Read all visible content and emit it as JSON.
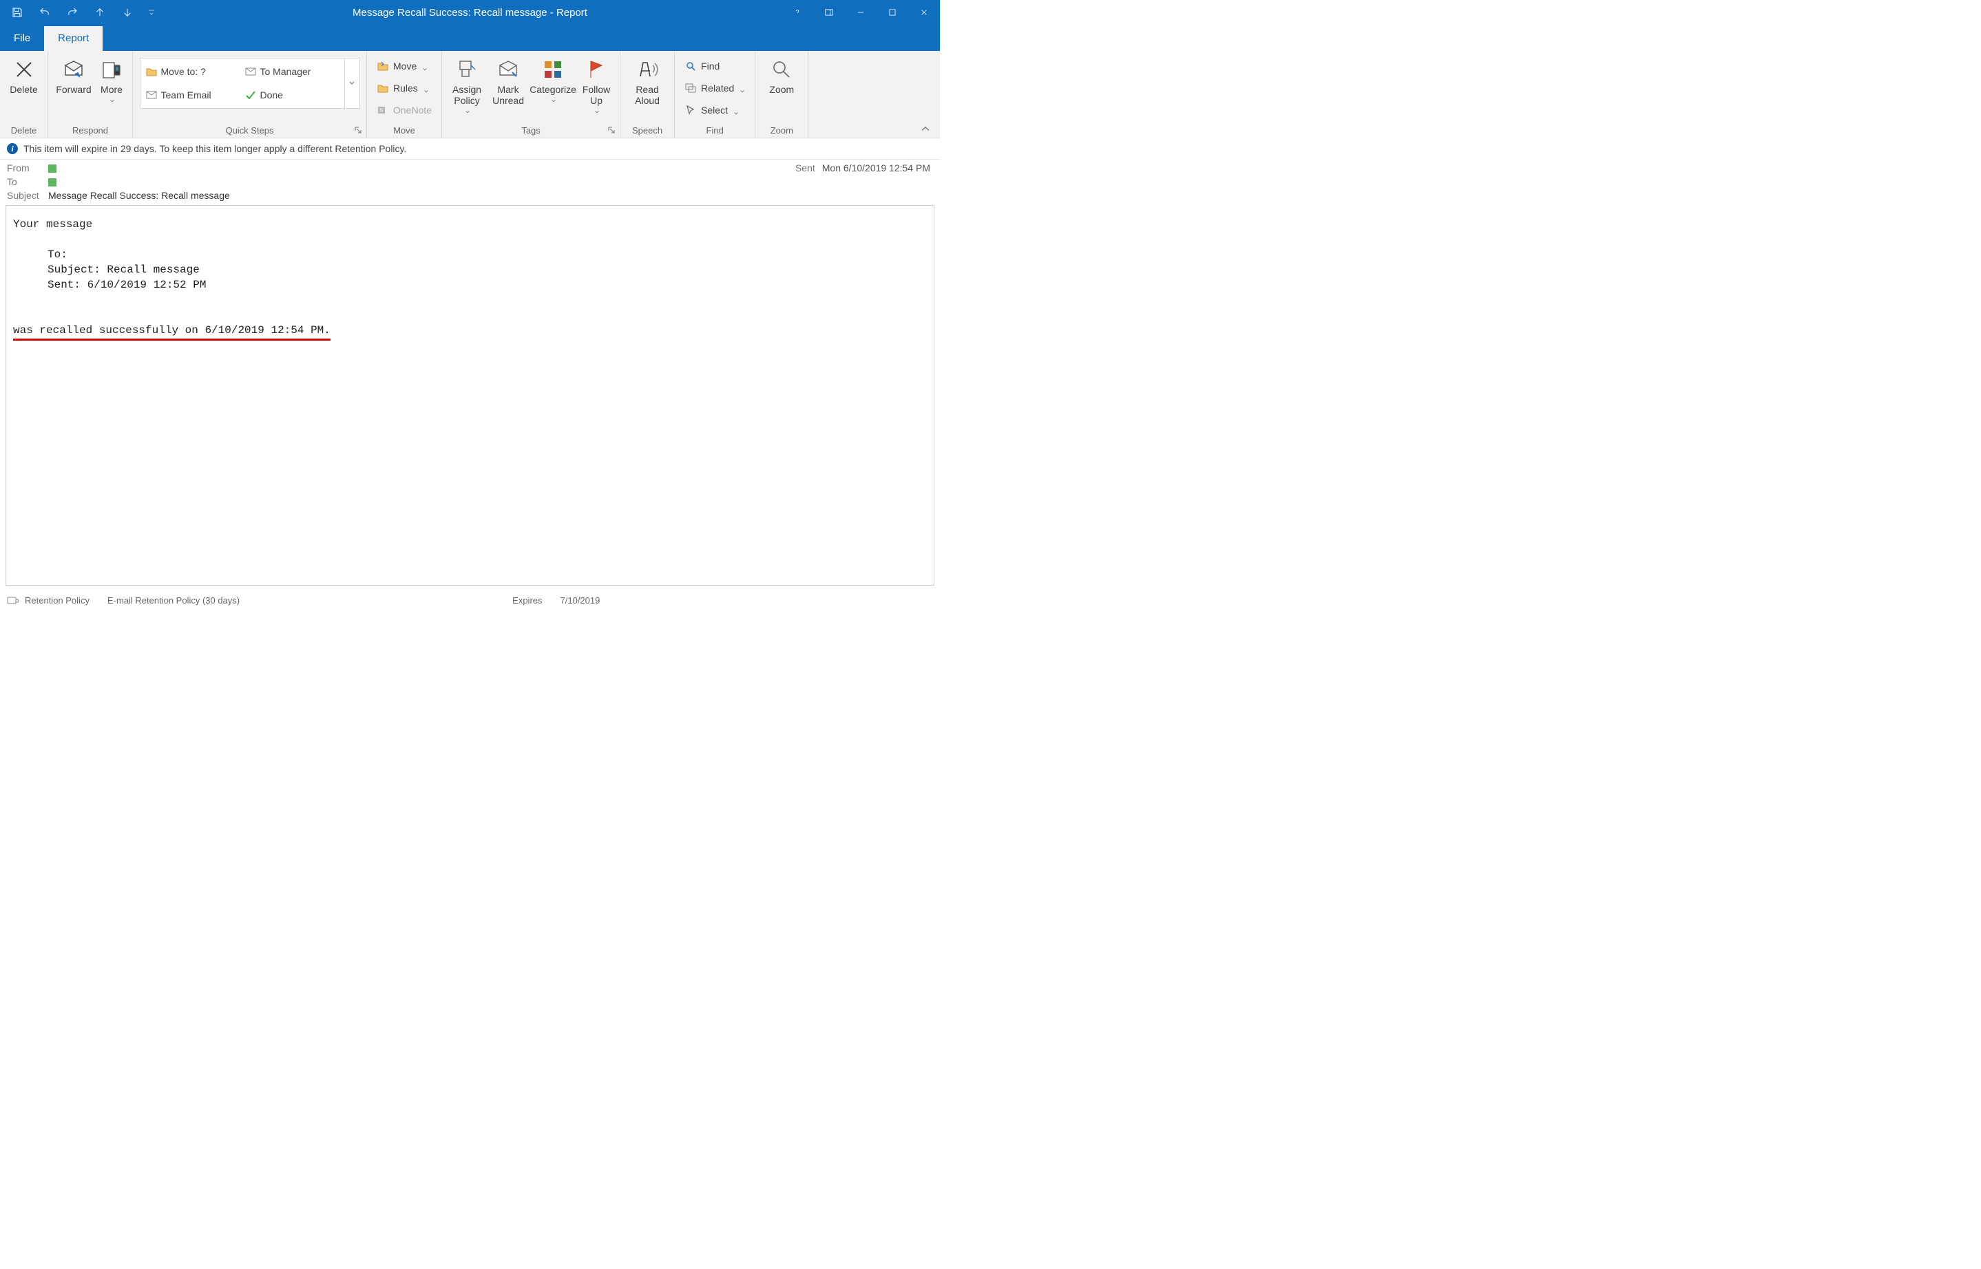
{
  "title": "Message Recall Success: Recall message  -  Report",
  "tabs": {
    "file": "File",
    "report": "Report"
  },
  "ribbon": {
    "delete_group": {
      "label": "Delete",
      "delete": "Delete"
    },
    "respond_group": {
      "label": "Respond",
      "forward": "Forward",
      "more": "More"
    },
    "quicksteps_group": {
      "label": "Quick Steps",
      "items": {
        "moveto": "Move to: ?",
        "tomanager": "To Manager",
        "teamemail": "Team Email",
        "done": "Done"
      }
    },
    "move_group": {
      "label": "Move",
      "move": "Move",
      "rules": "Rules",
      "onenote": "OneNote"
    },
    "tags_group": {
      "label": "Tags",
      "assign_policy": "Assign Policy",
      "mark_unread": "Mark Unread",
      "categorize": "Categorize",
      "follow_up": "Follow Up"
    },
    "speech_group": {
      "label": "Speech",
      "read_aloud": "Read Aloud"
    },
    "find_group": {
      "label": "Find",
      "find": "Find",
      "related": "Related",
      "select": "Select"
    },
    "zoom_group": {
      "label": "Zoom",
      "zoom": "Zoom"
    }
  },
  "infobar": "This item will expire in 29 days. To keep this item longer apply a different Retention Policy.",
  "header": {
    "from_label": "From",
    "to_label": "To",
    "subject_label": "Subject",
    "subject_value": "Message Recall Success: Recall message",
    "sent_label": "Sent",
    "sent_value": "Mon 6/10/2019 12:54 PM"
  },
  "body": {
    "your_message": "Your message",
    "to_line": "To:",
    "subject_line": "Subject:    Recall message",
    "sent_line": "Sent:  6/10/2019 12:52 PM",
    "recalled_line": "was recalled successfully on 6/10/2019 12:54 PM."
  },
  "status": {
    "rp_label": "Retention Policy",
    "rp_value": "E-mail Retention Policy (30 days)",
    "expires_label": "Expires",
    "expires_value": "7/10/2019"
  }
}
